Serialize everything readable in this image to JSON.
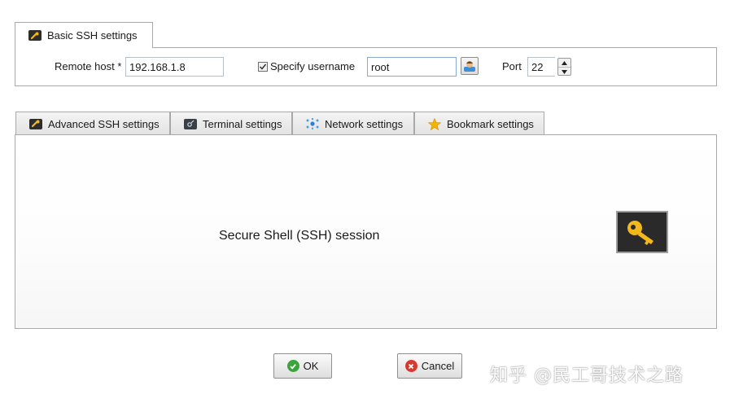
{
  "basic_tab": {
    "label": "Basic SSH settings"
  },
  "basic": {
    "remote_host_label": "Remote host *",
    "remote_host_value": "192.168.1.8",
    "specify_username_label": "Specify username",
    "specify_username_checked": true,
    "username_value": "root",
    "port_label": "Port",
    "port_value": "22"
  },
  "tabs": [
    {
      "label": "Advanced SSH settings",
      "icon": "wrench-icon"
    },
    {
      "label": "Terminal settings",
      "icon": "terminal-icon"
    },
    {
      "label": "Network settings",
      "icon": "network-icon"
    },
    {
      "label": "Bookmark settings",
      "icon": "star-icon"
    }
  ],
  "session": {
    "title": "Secure Shell (SSH) session",
    "icon": "key-icon"
  },
  "buttons": {
    "ok_label": "OK",
    "cancel_label": "Cancel"
  },
  "watermark": {
    "text": "知乎 @民工哥技术之路"
  },
  "colors": {
    "key": "#f2b81c",
    "ok_green": "#3aa53a",
    "cancel_red": "#d63a2f",
    "star": "#f4b400"
  }
}
